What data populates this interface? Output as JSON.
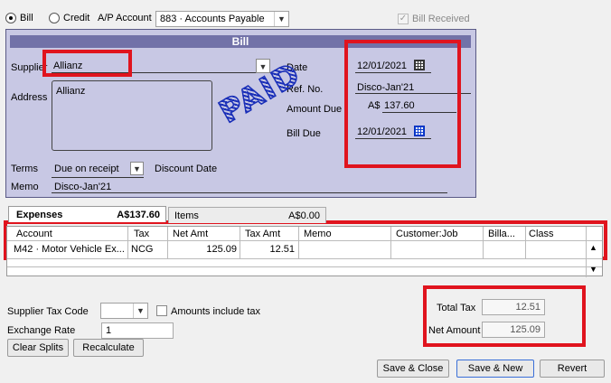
{
  "top": {
    "bill_label": "Bill",
    "credit_label": "Credit",
    "ap_account_label": "A/P Account",
    "ap_account_value": "883 · Accounts Payable",
    "bill_received_label": "Bill Received"
  },
  "form": {
    "title": "Bill",
    "supplier_label": "Supplier",
    "supplier_value": "Allianz",
    "address_label": "Address",
    "address_value": "Allianz",
    "terms_label": "Terms",
    "terms_value": "Due on receipt",
    "discount_date_label": "Discount Date",
    "memo_label": "Memo",
    "memo_value": "Disco-Jan'21",
    "date_label": "Date",
    "date_value": "12/01/2021",
    "ref_label": "Ref. No.",
    "ref_value": "Disco-Jan'21",
    "amount_due_label": "Amount Due",
    "amount_due_currency": "A$",
    "amount_due_value": "137.60",
    "bill_due_label": "Bill Due",
    "bill_due_value": "12/01/2021",
    "stamp": "PAID"
  },
  "tabs": {
    "expenses_label": "Expenses",
    "expenses_amount": "A$137.60",
    "items_label": "Items",
    "items_amount": "A$0.00"
  },
  "grid": {
    "headers": [
      "Account",
      "Tax",
      "Net Amt",
      "Tax Amt",
      "Memo",
      "Customer:Job",
      "Billa...",
      "Class"
    ],
    "row": {
      "account": "M42 · Motor Vehicle Ex...",
      "tax": "NCG",
      "net_amt": "125.09",
      "tax_amt": "12.51"
    }
  },
  "bottom": {
    "supplier_tax_code_label": "Supplier Tax Code",
    "amounts_include_tax_label": "Amounts include tax",
    "exchange_rate_label": "Exchange Rate",
    "exchange_rate_value": "1",
    "clear_splits_label": "Clear Splits",
    "recalculate_label": "Recalculate",
    "total_tax_label": "Total Tax",
    "total_tax_value": "12.51",
    "net_amount_label": "Net Amount",
    "net_amount_value": "125.09",
    "save_close_label": "Save & Close",
    "save_new_label": "Save & New",
    "revert_label": "Revert"
  },
  "colors": {
    "form_bg": "#c8c8e4",
    "form_header": "#7272a8",
    "highlight": "#e0141e",
    "stamp": "#1a2fb8"
  }
}
